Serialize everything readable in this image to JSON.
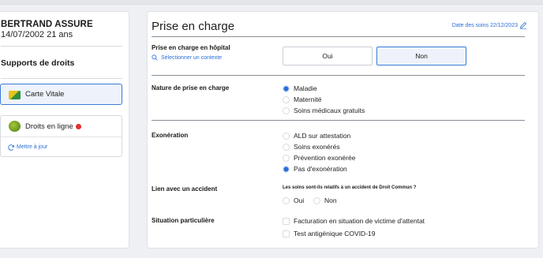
{
  "patient": {
    "name": "BERTRAND ASSURE",
    "dob_age": "14/07/2002 21 ans"
  },
  "supports": {
    "title": "Supports de droits",
    "carte_vitale": "Carte Vitale",
    "droits_en_ligne": "Droits en ligne",
    "mettre_a_jour": "Mettre à jour",
    "status_color": "#e0302a"
  },
  "main": {
    "title": "Prise en charge",
    "date_link": "Date des soins 22/12/2023",
    "hospital": {
      "label": "Prise en charge en hôpital",
      "context_link": "Sélectionner un contexte",
      "options": [
        "Oui",
        "Non"
      ],
      "selected": "Non"
    },
    "nature": {
      "label": "Nature de prise en charge",
      "options": [
        "Maladie",
        "Maternité",
        "Soins médicaux gratuits"
      ],
      "selected": "Maladie"
    },
    "exoneration": {
      "label": "Exonération",
      "options": [
        "ALD sur attestation",
        "Soins exonérés",
        "Prévention exonérée",
        "Pas d'exonération"
      ],
      "selected": "Pas d'exonération"
    },
    "accident": {
      "label": "Lien avec un accident",
      "question": "Les soins sont-ils relatifs à un accident de Droit Commun ?",
      "options": [
        "Oui",
        "Non"
      ]
    },
    "situation": {
      "label": "Situation particulière",
      "options": [
        "Facturation en situation de victime d'attentat",
        "Test antigénique COVID-19"
      ]
    }
  },
  "colors": {
    "accent": "#2b6fd6",
    "selected_bg": "#eef3fb",
    "page_bg": "#eef0f3"
  }
}
